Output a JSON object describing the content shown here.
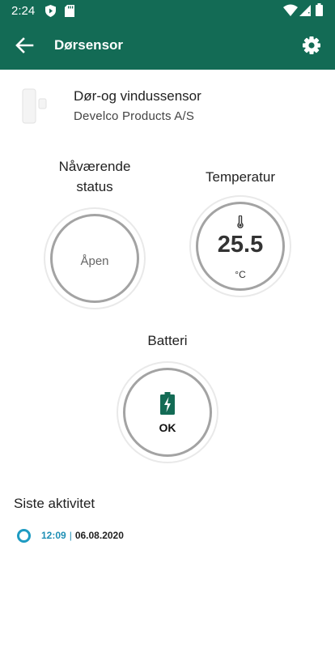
{
  "status_bar": {
    "time": "2:24",
    "left_icons": [
      "shield-play-icon",
      "sd-card-icon"
    ],
    "right_icons": [
      "wifi-icon",
      "signal-icon",
      "battery-icon"
    ]
  },
  "app_bar": {
    "title": "Dørsensor",
    "back_icon": "arrow-back-icon",
    "settings_icon": "gear-icon",
    "color": "#136b55"
  },
  "device": {
    "name": "Dør-og vindussensor",
    "manufacturer": "Develco Products A/S"
  },
  "status": {
    "label": "Nåværende status",
    "value": "Åpen"
  },
  "temperature": {
    "label": "Temperatur",
    "value": "25.5",
    "unit": "°C",
    "icon": "thermometer-icon"
  },
  "battery": {
    "label": "Batteri",
    "value": "OK",
    "icon": "battery-charging-icon",
    "color": "#136b55"
  },
  "activity": {
    "title": "Siste aktivitet",
    "items": [
      {
        "time": "12:09",
        "separator": "|",
        "date": "06.08.2020"
      }
    ],
    "accent": "#1e9bc2"
  }
}
